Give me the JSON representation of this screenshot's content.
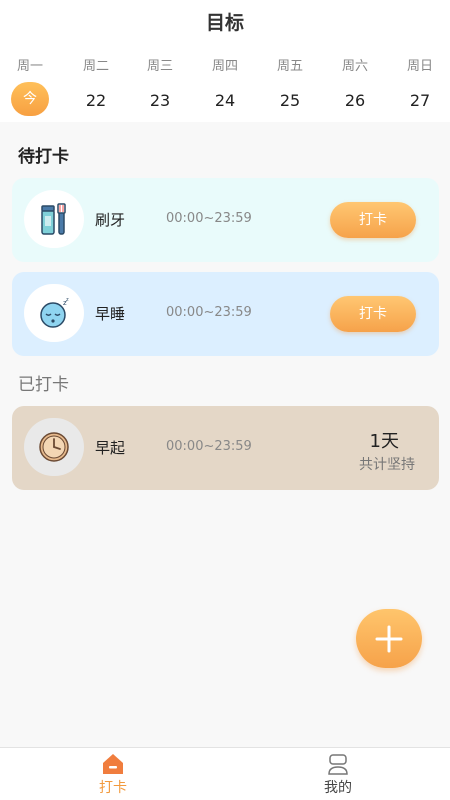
{
  "header": {
    "title": "目标"
  },
  "week": [
    {
      "weekday": "周一",
      "date": "今",
      "today": true
    },
    {
      "weekday": "周二",
      "date": "22"
    },
    {
      "weekday": "周三",
      "date": "23"
    },
    {
      "weekday": "周四",
      "date": "24"
    },
    {
      "weekday": "周五",
      "date": "25"
    },
    {
      "weekday": "周六",
      "date": "26"
    },
    {
      "weekday": "周日",
      "date": "27"
    }
  ],
  "pending": {
    "title": "待打卡",
    "items": [
      {
        "name": "刷牙",
        "time": "00:00~23:59",
        "button": "打卡",
        "icon": "toothbrush-icon"
      },
      {
        "name": "早睡",
        "time": "00:00~23:59",
        "button": "打卡",
        "icon": "sleeping-face-icon"
      }
    ]
  },
  "done": {
    "title": "已打卡",
    "items": [
      {
        "name": "早起",
        "time": "00:00~23:59",
        "count": "1天",
        "count_label": "共计坚持",
        "icon": "clock-icon"
      }
    ]
  },
  "fab": {
    "icon": "plus-icon"
  },
  "tabbar": {
    "tabs": [
      {
        "label": "打卡",
        "icon": "home-icon",
        "active": true
      },
      {
        "label": "我的",
        "icon": "user-icon",
        "active": false
      }
    ]
  },
  "colors": {
    "accent": "#f6a24a",
    "card_toothbrush": "#e9fbfb",
    "card_sleep": "#dcefff",
    "card_done": "#e4d7c7"
  }
}
